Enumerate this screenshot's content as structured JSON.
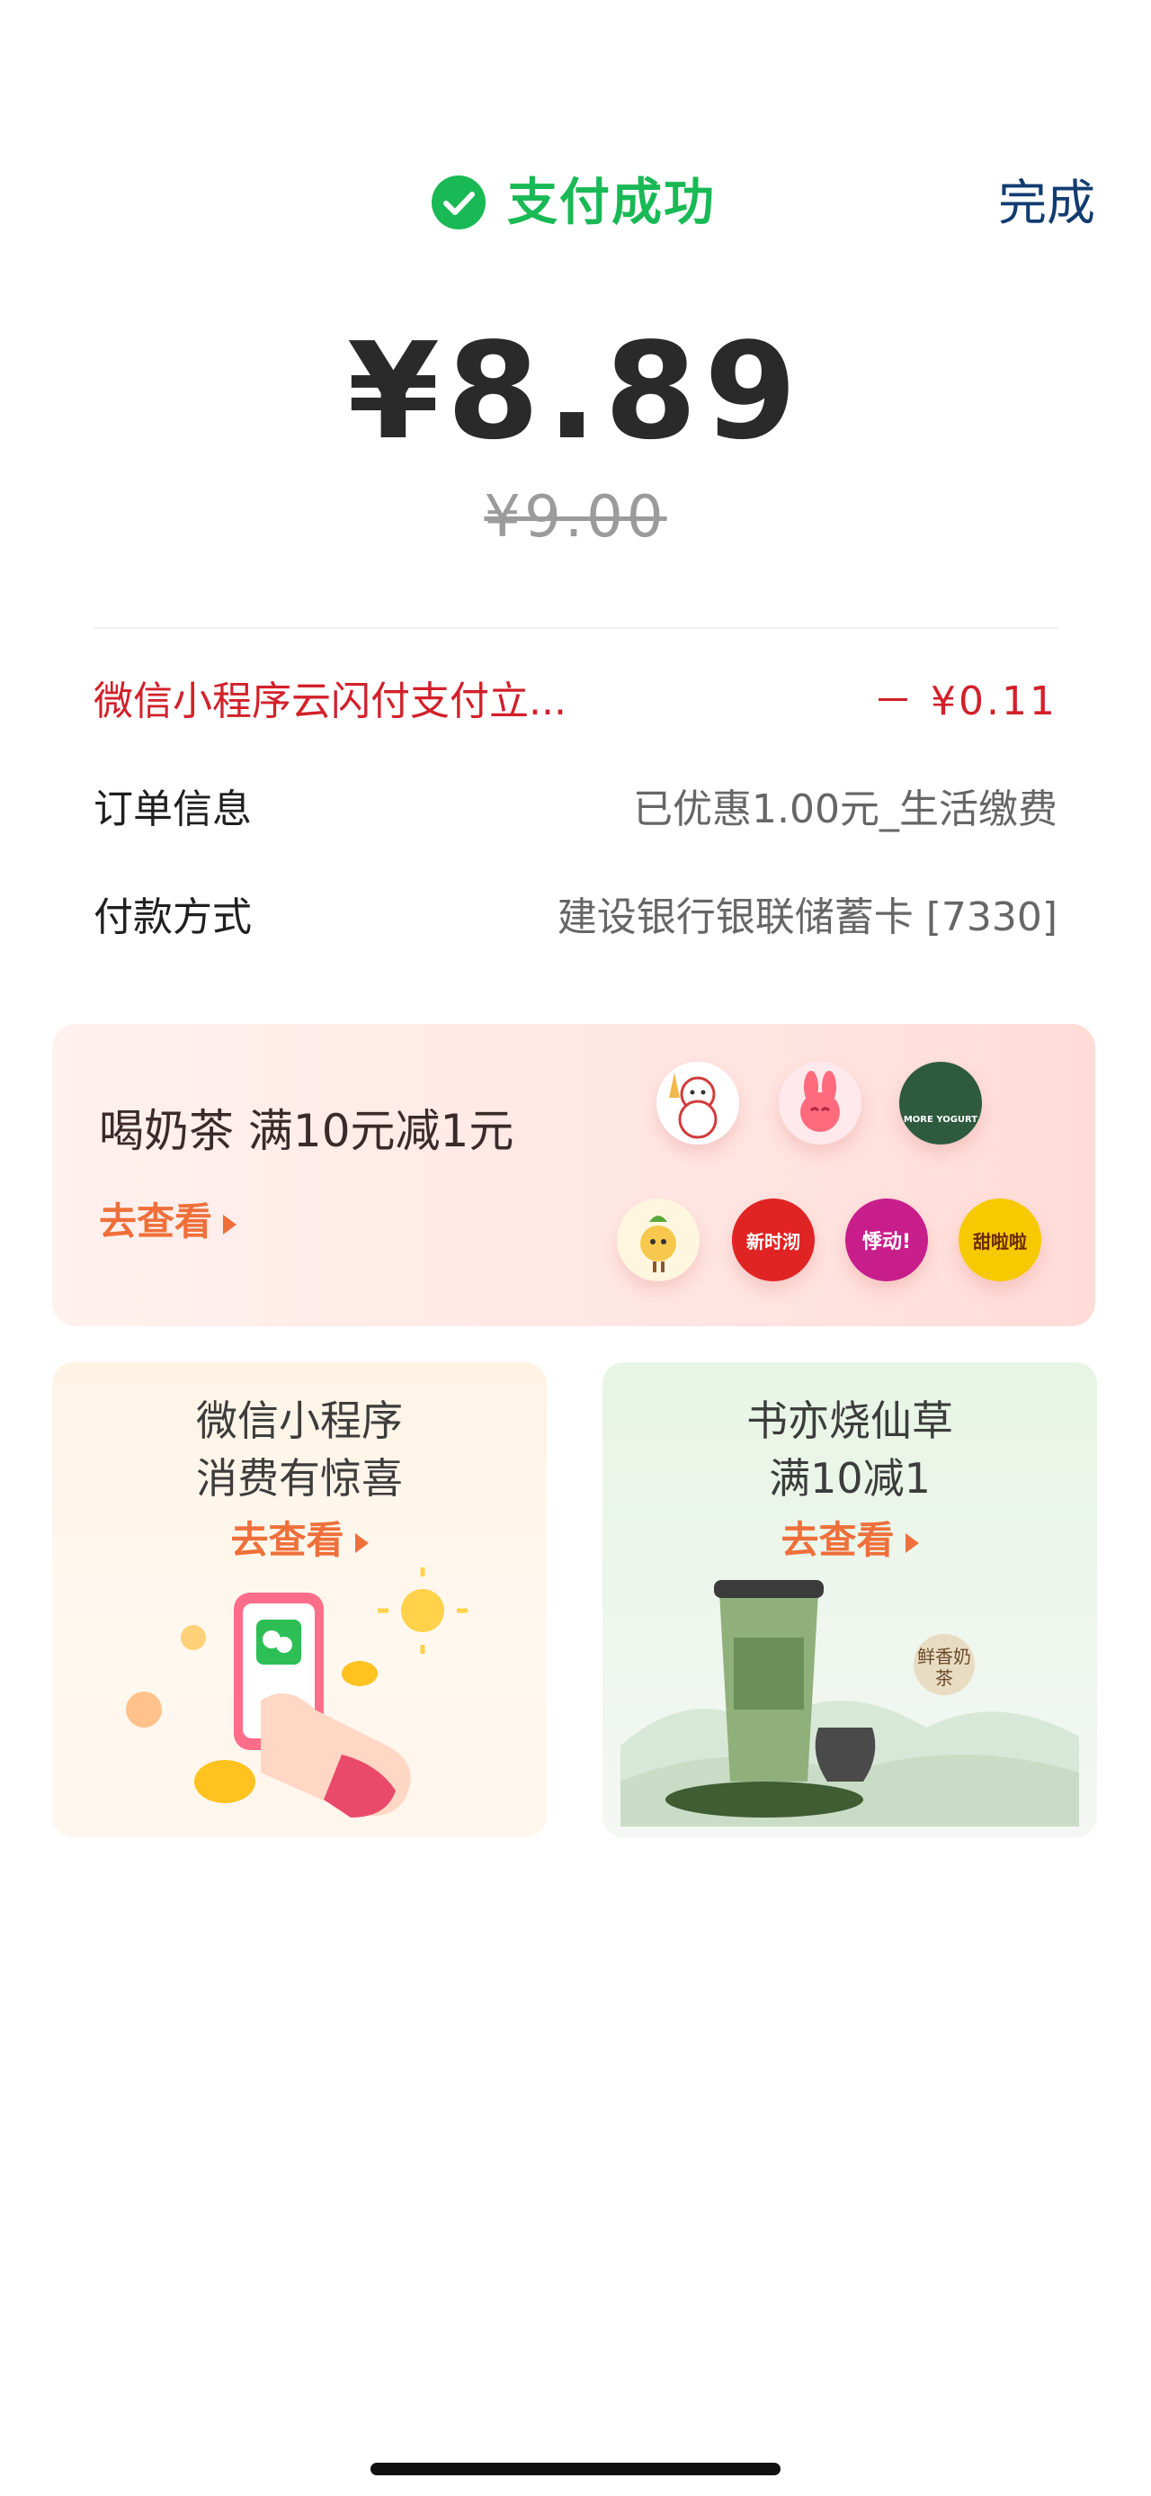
{
  "header": {
    "status": "支付成功",
    "done_label": "完成",
    "accent_color": "#19b955"
  },
  "payment": {
    "amount": "¥8.89",
    "original_amount": "¥9.00"
  },
  "details": [
    {
      "label": "微信小程序云闪付支付立...",
      "value": "－ ¥0.11"
    },
    {
      "label": "订单信息",
      "value": "已优惠1.00元_生活缴费"
    },
    {
      "label": "付款方式",
      "value": "建设银行银联储蓄卡 [7330]"
    }
  ],
  "promo_card": {
    "title": "喝奶茶 满10元减1元",
    "link": "去查看",
    "logos": [
      {
        "name": "snowman-mascot-logo",
        "color": "#ffffff",
        "text": ""
      },
      {
        "name": "pink-rabbit-logo",
        "color": "#ff6b7d",
        "text": ""
      },
      {
        "name": "more-yogurt-logo",
        "color": "#2e5a3e",
        "text": "MORE YOGURT"
      },
      {
        "name": "fruit-mascot-logo",
        "color": "#f7c84d",
        "text": ""
      },
      {
        "name": "new-shop-logo",
        "color": "#e02424",
        "text": "新时沏"
      },
      {
        "name": "heartbeat-logo",
        "color": "#c81e8c",
        "text": "悸动!"
      },
      {
        "name": "sweet-logo",
        "color": "#f6c900",
        "text": "甜啦啦"
      }
    ]
  },
  "cards": [
    {
      "line1": "微信小程序",
      "line2": "消费有惊喜",
      "link": "去查看"
    },
    {
      "line1": "书亦烧仙草",
      "line2": "满10减1",
      "link": "去查看",
      "cup_text": "鲜香奶茶"
    }
  ]
}
